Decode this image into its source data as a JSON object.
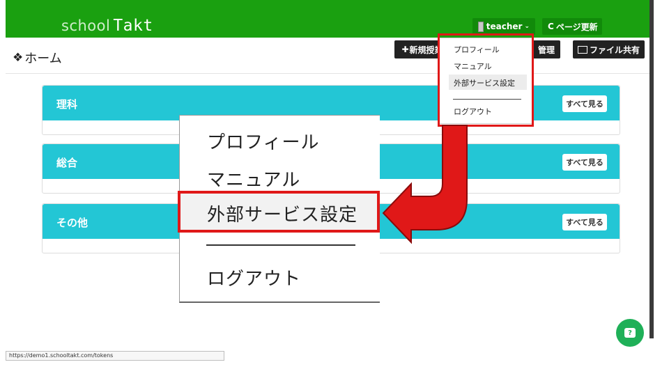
{
  "app": {
    "logo_school": "school",
    "logo_takt": "Takt"
  },
  "header": {
    "user_label": "teacher",
    "refresh_label": "ページ更新"
  },
  "page": {
    "title": "ホーム"
  },
  "actions": {
    "new_lesson": "新規授業",
    "manage": "管理",
    "file_share": "ファイル共有"
  },
  "panels": [
    {
      "title": "理科",
      "see_all": "すべて見る"
    },
    {
      "title": "総合",
      "see_all": "すべて見る"
    },
    {
      "title": "その他",
      "see_all": "すべて見る"
    }
  ],
  "user_menu": {
    "items": [
      "プロフィール",
      "マニュアル",
      "外部サービス設定",
      "ログアウト"
    ],
    "highlighted": "外部サービス設定"
  },
  "status": {
    "url": "https://demo1.schooltakt.com/tokens"
  },
  "icons": {
    "home": "home-icon",
    "user": "user-avatar-icon",
    "refresh": "refresh-icon",
    "plus": "plus-icon",
    "picture": "picture-icon",
    "help": "help-chat-icon"
  },
  "colors": {
    "topbar": "#1aa010",
    "panel_head": "#23c6d5",
    "highlight_red": "#e01818",
    "help_button": "#1fb058"
  }
}
